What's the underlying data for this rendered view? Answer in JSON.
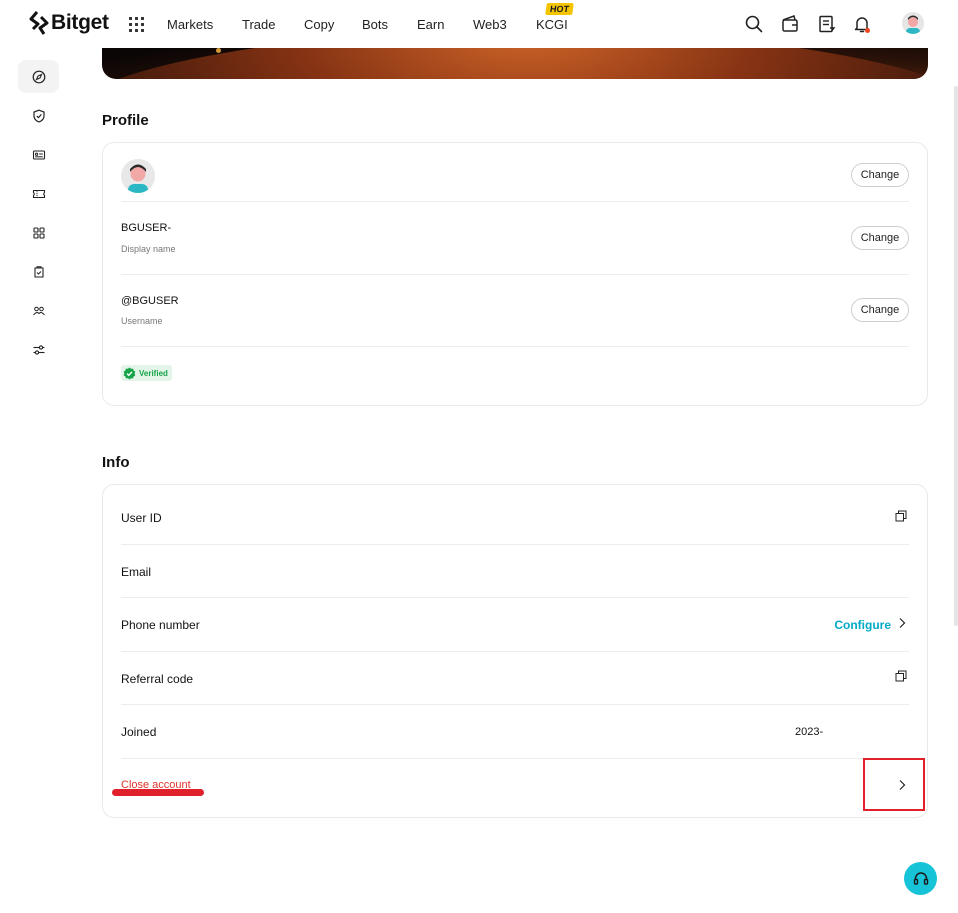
{
  "brand": {
    "name": "Bitget"
  },
  "nav": {
    "items": [
      "Markets",
      "Trade",
      "Copy",
      "Bots",
      "Earn",
      "Web3",
      "KCGI"
    ],
    "hot_badge": "HOT"
  },
  "top_icons": [
    "search-icon",
    "wallet-icon",
    "orders-icon",
    "bell-icon",
    "avatar"
  ],
  "sidebar": {
    "items": [
      "compass-icon",
      "shield-icon",
      "id-card-icon",
      "ticket-icon",
      "apps-grid-icon",
      "clipboard-icon",
      "people-icon",
      "sliders-icon"
    ],
    "active_index": 0
  },
  "profile": {
    "title": "Profile",
    "change_label": "Change",
    "display_name": "BGUSER-",
    "display_name_label": "Display name",
    "username": "@BGUSER",
    "username_label": "Username",
    "verified_label": "Verified"
  },
  "info": {
    "title": "Info",
    "rows": {
      "user_id": "User ID",
      "email": "Email",
      "phone": "Phone number",
      "phone_action": "Configure",
      "referral": "Referral code",
      "joined": "Joined",
      "joined_value": "2023-",
      "close_account": "Close account"
    }
  },
  "colors": {
    "accent": "#03a9c6",
    "danger": "#e0302a",
    "verified": "#16a34a",
    "hot": "#f5c400",
    "support": "#17c3d6"
  }
}
